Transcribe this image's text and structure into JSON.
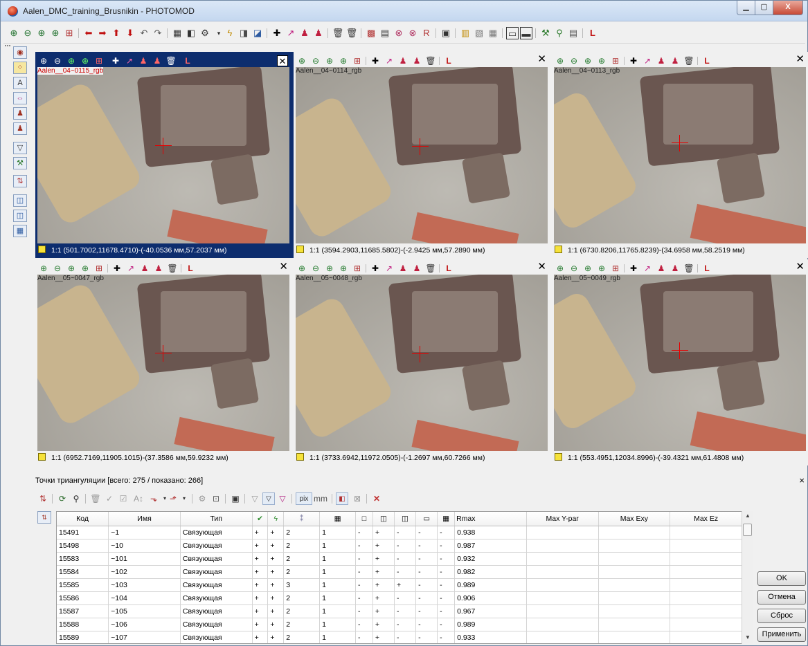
{
  "window": {
    "title": "Aalen_DMC_training_Brusnikin - PHOTOMOD",
    "min_label": "▁",
    "max_label": "▢",
    "close_label": "X"
  },
  "panes": [
    {
      "image_label": "Aalen__04~0115_rgb",
      "status": "1:1 (501.7002,11678.4710)-(-40.0536 мм,57.2037 мм)",
      "active": true
    },
    {
      "image_label": "Aalen__04~0114_rgb",
      "status": "1:1 (3594.2903,11685.5802)-(-2.9425 мм,57.2890 мм)",
      "active": false
    },
    {
      "image_label": "Aalen__04~0113_rgb",
      "status": "1:1 (6730.8206,11765.8239)-(34.6958 мм,58.2519 мм)",
      "active": false
    },
    {
      "image_label": "Aalen__05~0047_rgb",
      "status": "1:1 (6952.7169,11905.1015)-(37.3586 мм,59.9232 мм)",
      "active": false
    },
    {
      "image_label": "Aalen__05~0048_rgb",
      "status": "1:1 (3733.6942,11972.0505)-(-1.2697 мм,60.7266 мм)",
      "active": false
    },
    {
      "image_label": "Aalen__05~0049_rgb",
      "status": "1:1 (553.4951,12034.8996)-(-39.4321 мм,61.4808 мм)",
      "active": false
    }
  ],
  "pane_close_label": "✕",
  "triangulation": {
    "header": "Точки триангуляции [всего: 275 / показано: 266]",
    "close_label": "×",
    "toolbar": {
      "pix_label": "pix",
      "mm_label": "mm"
    },
    "columns": [
      "Код",
      "Имя",
      "Тип",
      "✔",
      "ϟ",
      "⁑",
      "▦",
      "□",
      "◫",
      "◫",
      "▭",
      "▦",
      "Rmax",
      "Max Y-par",
      "Max Exy",
      "Max Ez"
    ],
    "rows": [
      [
        "15491",
        "~1",
        "Связующая",
        "+",
        "+",
        "2",
        "1",
        "-",
        "+",
        "-",
        "-",
        "-",
        "0.938",
        "",
        "",
        ""
      ],
      [
        "15498",
        "~10",
        "Связующая",
        "+",
        "+",
        "2",
        "1",
        "-",
        "+",
        "-",
        "-",
        "-",
        "0.987",
        "",
        "",
        ""
      ],
      [
        "15583",
        "~101",
        "Связующая",
        "+",
        "+",
        "2",
        "1",
        "-",
        "+",
        "-",
        "-",
        "-",
        "0.932",
        "",
        "",
        ""
      ],
      [
        "15584",
        "~102",
        "Связующая",
        "+",
        "+",
        "2",
        "1",
        "-",
        "+",
        "-",
        "-",
        "-",
        "0.982",
        "",
        "",
        ""
      ],
      [
        "15585",
        "~103",
        "Связующая",
        "+",
        "+",
        "3",
        "1",
        "-",
        "+",
        "+",
        "-",
        "-",
        "0.989",
        "",
        "",
        ""
      ],
      [
        "15586",
        "~104",
        "Связующая",
        "+",
        "+",
        "2",
        "1",
        "-",
        "+",
        "-",
        "-",
        "-",
        "0.906",
        "",
        "",
        ""
      ],
      [
        "15587",
        "~105",
        "Связующая",
        "+",
        "+",
        "2",
        "1",
        "-",
        "+",
        "-",
        "-",
        "-",
        "0.967",
        "",
        "",
        ""
      ],
      [
        "15588",
        "~106",
        "Связующая",
        "+",
        "+",
        "2",
        "1",
        "-",
        "+",
        "-",
        "-",
        "-",
        "0.989",
        "",
        "",
        ""
      ],
      [
        "15589",
        "~107",
        "Связующая",
        "+",
        "+",
        "2",
        "1",
        "-",
        "+",
        "-",
        "-",
        "-",
        "0.933",
        "",
        "",
        ""
      ]
    ]
  },
  "buttons": {
    "ok": "OK",
    "cancel": "Отмена",
    "reset": "Сброс",
    "apply": "Применить"
  },
  "colors": {
    "active_pane": "#0d2d6e",
    "crosshair": "#e60000"
  }
}
